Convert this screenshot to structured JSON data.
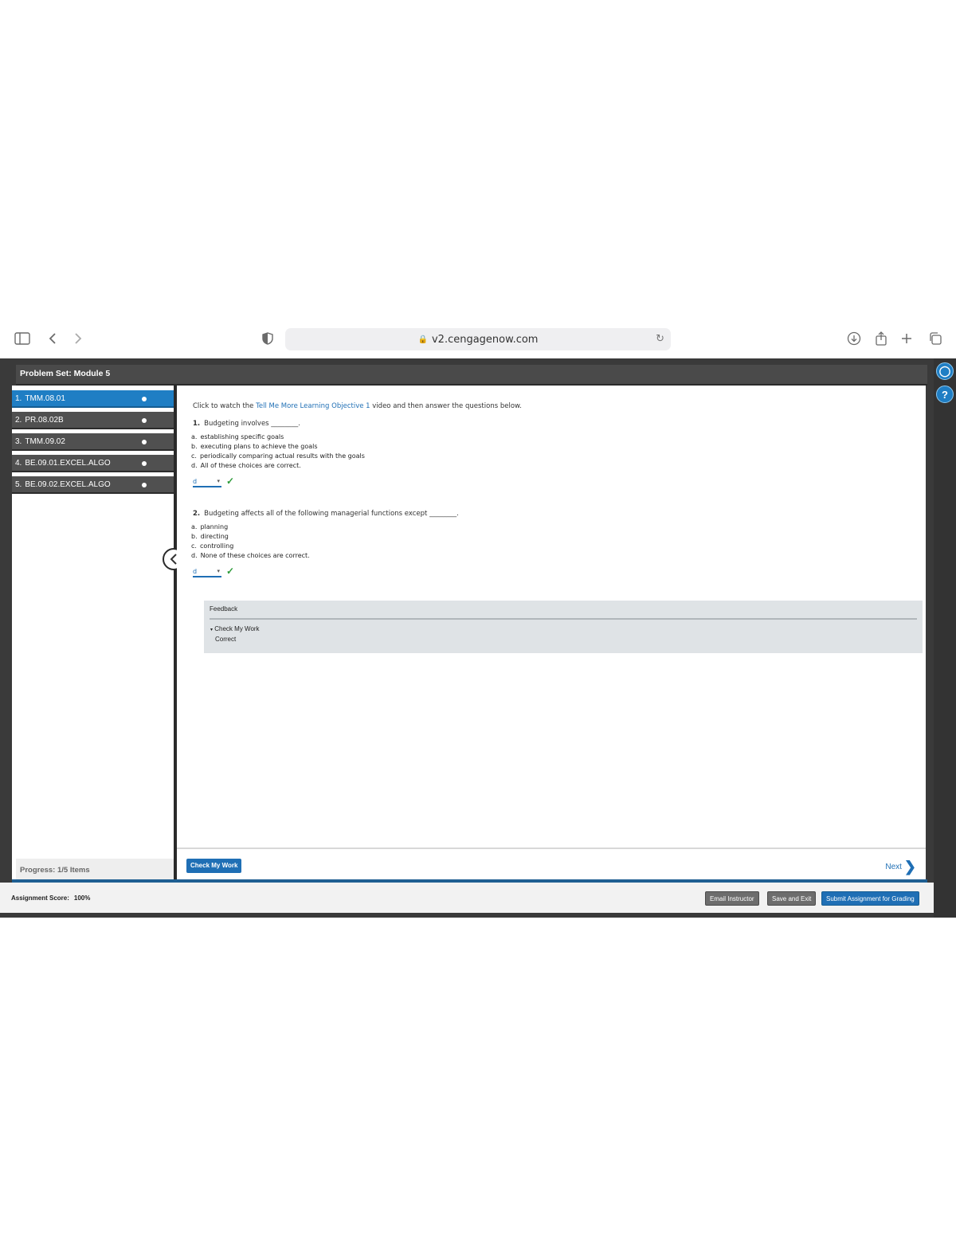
{
  "browser": {
    "url": "v2.cengagenow.com"
  },
  "app": {
    "title": "Problem Set: Module 5"
  },
  "nav": {
    "items": [
      {
        "num": "1.",
        "label": "TMM.08.01",
        "active": true
      },
      {
        "num": "2.",
        "label": "PR.08.02B",
        "active": false
      },
      {
        "num": "3.",
        "label": "TMM.09.02",
        "active": false
      },
      {
        "num": "4.",
        "label": "BE.09.01.EXCEL.ALGO",
        "active": false
      },
      {
        "num": "5.",
        "label": "BE.09.02.EXCEL.ALGO",
        "active": false
      }
    ],
    "progress": "Progress:  1/5 Items"
  },
  "content": {
    "intro_prefix": "Click to watch the ",
    "intro_link": "Tell Me More Learning Objective 1",
    "intro_suffix": " video and then answer the questions below.",
    "questions": [
      {
        "num": "1.",
        "text": "Budgeting involves ________.",
        "options": [
          {
            "letter": "a.",
            "text": "establishing specific goals"
          },
          {
            "letter": "b.",
            "text": "executing plans to achieve the goals"
          },
          {
            "letter": "c.",
            "text": "periodically comparing actual results with the goals"
          },
          {
            "letter": "d.",
            "text": "All of these choices are correct."
          }
        ],
        "answer": "d",
        "status_icon": "checkmark-icon"
      },
      {
        "num": "2.",
        "text": "Budgeting affects all of the following managerial functions except ________.",
        "options": [
          {
            "letter": "a.",
            "text": "planning"
          },
          {
            "letter": "b.",
            "text": "directing"
          },
          {
            "letter": "c.",
            "text": "controlling"
          },
          {
            "letter": "d.",
            "text": "None of these choices are correct."
          }
        ],
        "answer": "d",
        "status_icon": "checkmark-icon"
      }
    ],
    "feedback": {
      "title": "Feedback",
      "item": "Check My Work",
      "result": "Correct"
    }
  },
  "footer": {
    "check_button": "Check My Work",
    "next_label": "Next"
  },
  "bottom": {
    "score_label": "Assignment Score:",
    "score_value": "100%",
    "email_button": "Email Instructor",
    "save_button": "Save and Exit",
    "submit_button": "Submit Assignment for Grading"
  },
  "colors": {
    "accent": "#1f7ec4",
    "link": "#1f6fb5",
    "correct": "#2e9c3a"
  }
}
